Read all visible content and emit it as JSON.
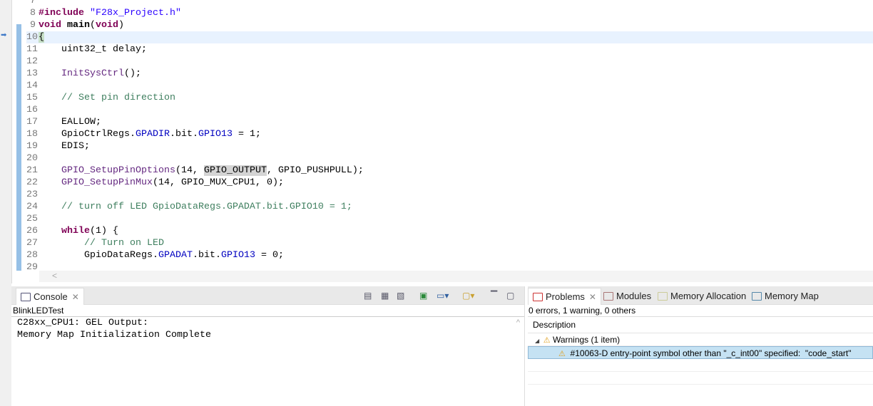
{
  "editor": {
    "current_line": 10,
    "lines": [
      {
        "n": "7",
        "t": []
      },
      {
        "n": "8",
        "t": [
          [
            "#include ",
            "kw"
          ],
          [
            "\"F28x_Project.h\"",
            "str"
          ]
        ]
      },
      {
        "n": "9",
        "t": [
          [
            "void",
            "kw"
          ],
          [
            " ",
            ""
          ],
          [
            "main",
            "bold"
          ],
          [
            "(",
            ""
          ],
          [
            "void",
            "kw"
          ],
          [
            ")",
            ""
          ]
        ]
      },
      {
        "n": "10",
        "t": [
          [
            "{",
            "br"
          ]
        ]
      },
      {
        "n": "11",
        "t": [
          [
            "    uint32_t delay;",
            ""
          ]
        ]
      },
      {
        "n": "12",
        "t": []
      },
      {
        "n": "13",
        "t": [
          [
            "    ",
            ""
          ],
          [
            "InitSysCtrl",
            "fn"
          ],
          [
            "();",
            ""
          ]
        ]
      },
      {
        "n": "14",
        "t": []
      },
      {
        "n": "15",
        "t": [
          [
            "    // Set pin direction",
            "cm"
          ]
        ]
      },
      {
        "n": "16",
        "t": []
      },
      {
        "n": "17",
        "t": [
          [
            "    EALLOW;",
            ""
          ]
        ]
      },
      {
        "n": "18",
        "t": [
          [
            "    GpioCtrlRegs.",
            ""
          ],
          [
            "GPADIR",
            "fld"
          ],
          [
            ".bit.",
            ""
          ],
          [
            "GPIO13",
            "fld"
          ],
          [
            " = 1;",
            ""
          ]
        ]
      },
      {
        "n": "19",
        "t": [
          [
            "    EDIS;",
            ""
          ]
        ]
      },
      {
        "n": "20",
        "t": []
      },
      {
        "n": "21",
        "t": [
          [
            "    ",
            ""
          ],
          [
            "GPIO_SetupPinOptions",
            "fn"
          ],
          [
            "(14, ",
            ""
          ],
          [
            "GPIO_OUTPUT",
            "hl"
          ],
          [
            ", GPIO_PUSHPULL);",
            ""
          ]
        ]
      },
      {
        "n": "22",
        "t": [
          [
            "    ",
            ""
          ],
          [
            "GPIO_SetupPinMux",
            "fn"
          ],
          [
            "(14, GPIO_MUX_CPU1, 0);",
            ""
          ]
        ]
      },
      {
        "n": "23",
        "t": []
      },
      {
        "n": "24",
        "t": [
          [
            "    // turn off LED GpioDataRegs.GPADAT.bit.GPIO10 = 1;",
            "cm"
          ]
        ]
      },
      {
        "n": "25",
        "t": []
      },
      {
        "n": "26",
        "t": [
          [
            "    ",
            ""
          ],
          [
            "while",
            "kw"
          ],
          [
            "(1) {",
            ""
          ]
        ]
      },
      {
        "n": "27",
        "t": [
          [
            "        // Turn on LED",
            "cm"
          ]
        ]
      },
      {
        "n": "28",
        "t": [
          [
            "        GpioDataRegs.",
            ""
          ],
          [
            "GPADAT",
            "fld"
          ],
          [
            ".bit.",
            ""
          ],
          [
            "GPIO13",
            "fld"
          ],
          [
            " = 0;",
            ""
          ]
        ]
      },
      {
        "n": "29",
        "t": []
      }
    ],
    "scroll_left": "<"
  },
  "console": {
    "tab_label": "Console",
    "close": "✕",
    "name": "BlinkLEDTest",
    "output": [
      "C28xx_CPU1: GEL Output:",
      "Memory Map Initialization Complete"
    ],
    "scroll_up": "^"
  },
  "problems": {
    "tabs": [
      "Problems",
      "Modules",
      "Memory Allocation",
      "Memory Map"
    ],
    "close": "✕",
    "summary": "0 errors, 1 warning, 0 others",
    "column": "Description",
    "group": "Warnings (1 item)",
    "items": [
      "#10063-D entry-point symbol other than \"_c_int00\" specified:  \"code_start\""
    ],
    "warning_icon": "⚠"
  }
}
